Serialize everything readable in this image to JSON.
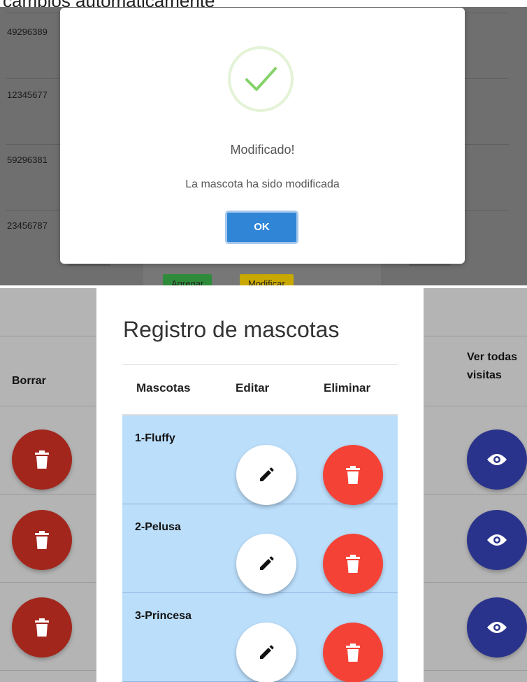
{
  "top_caption": "cambios automaticamente",
  "background_list": {
    "phones": [
      "49296389",
      "12345677",
      "59296381",
      "23456787"
    ],
    "add_label": "Agregar",
    "modify_label": "Modificar"
  },
  "modal": {
    "title": "Modificado!",
    "text": "La mascota ha sido modificada",
    "ok_label": "OK",
    "success_icon": "checkmark-icon"
  },
  "background_table": {
    "delete_header": "Borrar",
    "view_header": "Ver todas visitas"
  },
  "card": {
    "title": "Registro de mascotas",
    "columns": [
      "Mascotas",
      "Editar",
      "Eliminar"
    ],
    "pets": [
      {
        "name": "1-Fluffy"
      },
      {
        "name": "2-Pelusa"
      },
      {
        "name": "3-Princesa"
      }
    ]
  },
  "colors": {
    "ok_button": "#3085d6",
    "delete_button": "#f44336",
    "table_row": "#bbdefb",
    "success": "#7cd15f",
    "view_button": "#2a338b"
  }
}
